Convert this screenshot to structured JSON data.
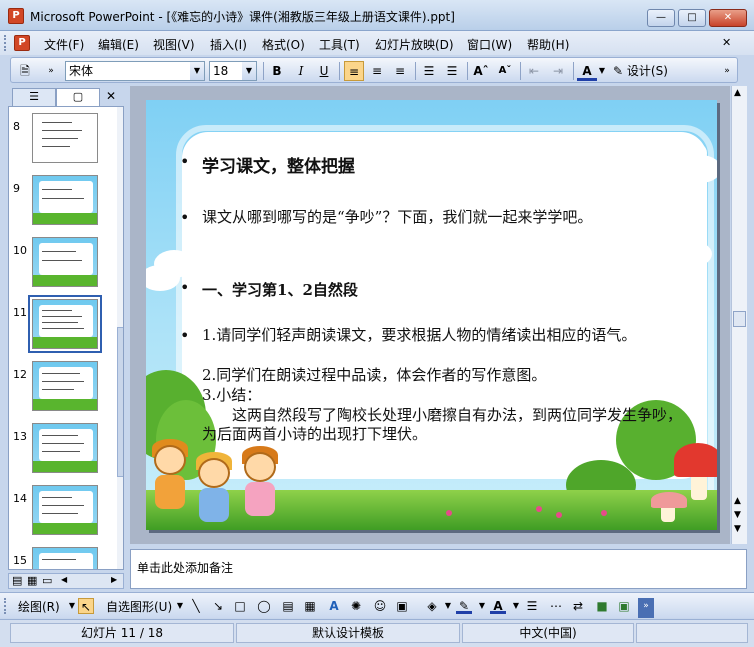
{
  "window": {
    "title": "Microsoft PowerPoint - [《难忘的小诗》课件(湘教版三年级上册语文课件).ppt]",
    "app_icon": "P"
  },
  "menu": {
    "items": [
      "文件(F)",
      "编辑(E)",
      "视图(V)",
      "插入(I)",
      "格式(O)",
      "工具(T)",
      "幻灯片放映(D)",
      "窗口(W)",
      "帮助(H)"
    ]
  },
  "format_toolbar": {
    "font_name": "宋体",
    "font_size": "18",
    "bold": "B",
    "italic": "I",
    "underline": "U",
    "font_color_letter": "A",
    "design_label": "设计(S)"
  },
  "left_pane": {
    "thumbnails": [
      {
        "number": "8"
      },
      {
        "number": "9"
      },
      {
        "number": "10"
      },
      {
        "number": "11",
        "selected": true
      },
      {
        "number": "12"
      },
      {
        "number": "13"
      },
      {
        "number": "14"
      },
      {
        "number": "15"
      }
    ]
  },
  "slide": {
    "title": "学习课文，整体把握",
    "intro": "课文从哪到哪写的是“争吵”？下面，我们就一起来学学吧。",
    "section": "一、学习第1、2自然段",
    "item1": "1.请同学们轻声朗读课文，要求根据人物的情绪读出相应的语气。",
    "item2": "2.同学们在朗读过程中品读，体会作者的写作意图。",
    "item3": "3.小结：",
    "summary": "这两自然段写了陶校长处理小磨擦自有办法，到两位同学发生争吵，为后面两首小诗的出现打下埋伏。",
    "bullet_glyph": "•"
  },
  "notes": {
    "placeholder": "单击此处添加备注"
  },
  "draw_toolbar": {
    "draw_label": "绘图(R)",
    "autoshapes_label": "自选图形(U)"
  },
  "status": {
    "slide_position": "幻灯片 11 / 18",
    "template": "默认设计模板",
    "language": "中文(中国)"
  }
}
